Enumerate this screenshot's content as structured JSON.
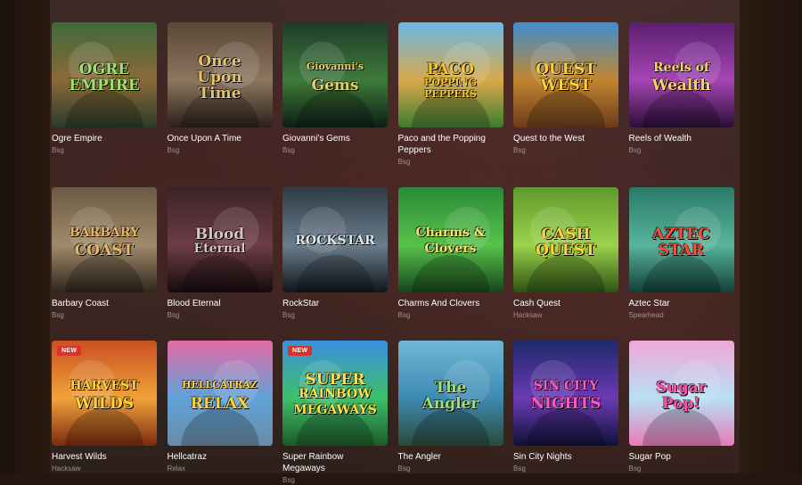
{
  "rows": [
    [
      {
        "title": "Ogre Empire",
        "provider": "Bsg",
        "art": [
          "OGRE",
          "EMPIRE"
        ],
        "colors": [
          "#3f6a3a",
          "#8b6a3a",
          "#2a3b28"
        ],
        "text_color": "#9fe070"
      },
      {
        "title": "Once Upon A Time",
        "provider": "Bsg",
        "art": [
          "Once",
          "Upon",
          "Time"
        ],
        "colors": [
          "#5b4736",
          "#8d7660",
          "#2b2019"
        ],
        "text_color": "#e5c36a"
      },
      {
        "title": "Giovanni's Gems",
        "provider": "Bsg",
        "art": [
          "Giovanni's",
          "Gems"
        ],
        "colors": [
          "#1e3b2a",
          "#3f7a3a",
          "#0e1e14"
        ],
        "text_color": "#e8cf6a"
      },
      {
        "title": "Paco and the Popping Peppers",
        "provider": "Bsg",
        "art": [
          "PACO",
          "POPPING PEPPERS"
        ],
        "colors": [
          "#6bb7e8",
          "#d8a94a",
          "#3e7a2f"
        ],
        "text_color": "#f4c531"
      },
      {
        "title": "Quest to the West",
        "provider": "Bsg",
        "art": [
          "QUEST",
          "WEST"
        ],
        "colors": [
          "#3f8fd0",
          "#c2852f",
          "#6a3b1a"
        ],
        "text_color": "#ffcf3a"
      },
      {
        "title": "Reels of Wealth",
        "provider": "Bsg",
        "art": [
          "Reels of",
          "Wealth"
        ],
        "colors": [
          "#5a1f6e",
          "#a645b5",
          "#2a0e35"
        ],
        "text_color": "#f2d36a"
      }
    ],
    [
      {
        "title": "Barbary Coast",
        "provider": "Bsg",
        "art": [
          "BARBARY",
          "COAST"
        ],
        "colors": [
          "#6b5a44",
          "#a08a6a",
          "#2f261c"
        ],
        "text_color": "#e7b56a"
      },
      {
        "title": "Blood Eternal",
        "provider": "Bsg",
        "art": [
          "Blood",
          "Eternal"
        ],
        "colors": [
          "#3a2327",
          "#6d3d45",
          "#140b0d"
        ],
        "text_color": "#d9c3c3"
      },
      {
        "title": "RockStar",
        "provider": "Bsg",
        "art": [
          "ROCKSTAR"
        ],
        "colors": [
          "#2e3a45",
          "#6a7d8c",
          "#10161b"
        ],
        "text_color": "#dfe6ea"
      },
      {
        "title": "Charms And Clovers",
        "provider": "Bsg",
        "art": [
          "Charms &",
          "Clovers"
        ],
        "colors": [
          "#2a8a38",
          "#58c24a",
          "#15461c"
        ],
        "text_color": "#f7e36a"
      },
      {
        "title": "Cash Quest",
        "provider": "Hacksaw",
        "art": [
          "CASH",
          "QUEST"
        ],
        "colors": [
          "#5e9a2e",
          "#9bd24a",
          "#2e5214"
        ],
        "text_color": "#ffd23a"
      },
      {
        "title": "Aztec Star",
        "provider": "Spearhead",
        "art": [
          "AZTEC",
          "STAR"
        ],
        "colors": [
          "#2a7a6a",
          "#58b49a",
          "#124037"
        ],
        "text_color": "#ff4b3a"
      }
    ],
    [
      {
        "title": "Harvest Wilds",
        "provider": "Hacksaw",
        "art": [
          "HARVEST",
          "WILDS"
        ],
        "colors": [
          "#c9501f",
          "#f0a23a",
          "#7a2a10"
        ],
        "text_color": "#ffd23a",
        "badge": "NEW"
      },
      {
        "title": "Hellcatraz",
        "provider": "Relax",
        "art": [
          "HELLCATRAZ",
          "RELAX"
        ],
        "colors": [
          "#e66aa8",
          "#5fa3d8",
          "#6a8aa8"
        ],
        "text_color": "#ffd23a"
      },
      {
        "title": "Super Rainbow Megaways",
        "provider": "Bsg",
        "art": [
          "SUPER",
          "RAINBOW",
          "MEGAWAYS"
        ],
        "colors": [
          "#3a8fe0",
          "#3ec06a",
          "#1c5a2a"
        ],
        "text_color": "#ffe04a",
        "badge": "NEW"
      },
      {
        "title": "The Angler",
        "provider": "Bsg",
        "art": [
          "The",
          "Angler"
        ],
        "colors": [
          "#6fb7d6",
          "#3d8ab2",
          "#2a4a3a"
        ],
        "text_color": "#9fe070"
      },
      {
        "title": "Sin City Nights",
        "provider": "Bsg",
        "art": [
          "SIN CITY",
          "NIGHTS"
        ],
        "colors": [
          "#1e2a6a",
          "#6a3ab5",
          "#0e1238"
        ],
        "text_color": "#ff5ab5"
      },
      {
        "title": "Sugar Pop",
        "provider": "Bsg",
        "art": [
          "Sugar",
          "Pop!"
        ],
        "colors": [
          "#f0a6d8",
          "#b6e0f4",
          "#e87ab8"
        ],
        "text_color": "#ff4fa8"
      }
    ]
  ]
}
